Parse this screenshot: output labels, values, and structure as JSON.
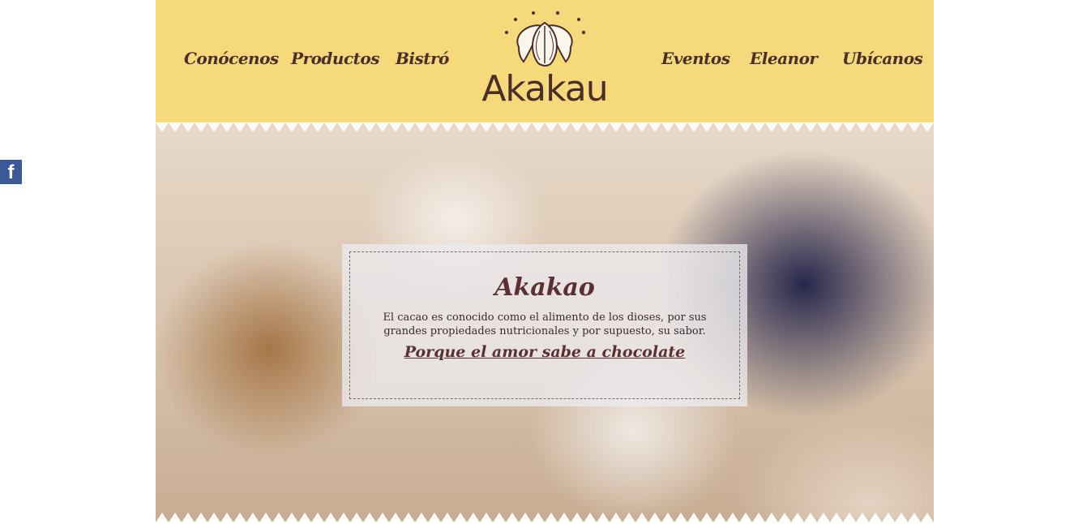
{
  "social": {
    "facebook_label": "f"
  },
  "nav": {
    "left": [
      "Conócenos",
      "Productos",
      "Bistró"
    ],
    "right": [
      "Eventos",
      "Eleanor",
      "Ubícanos"
    ]
  },
  "logo": {
    "text": "Akakau",
    "icon": "cacao-pod-icon"
  },
  "hero": {
    "title": "Akakao",
    "description": "El cacao es conocido como el alimento de los dioses, por sus grandes propiedades nutricionales y por supuesto, su sabor.",
    "link_text": "Porque el amor sabe a chocolate"
  },
  "colors": {
    "header_bg": "#f5d97a",
    "brand_brown": "#4a2e2a",
    "facebook_blue": "#3b5998"
  }
}
